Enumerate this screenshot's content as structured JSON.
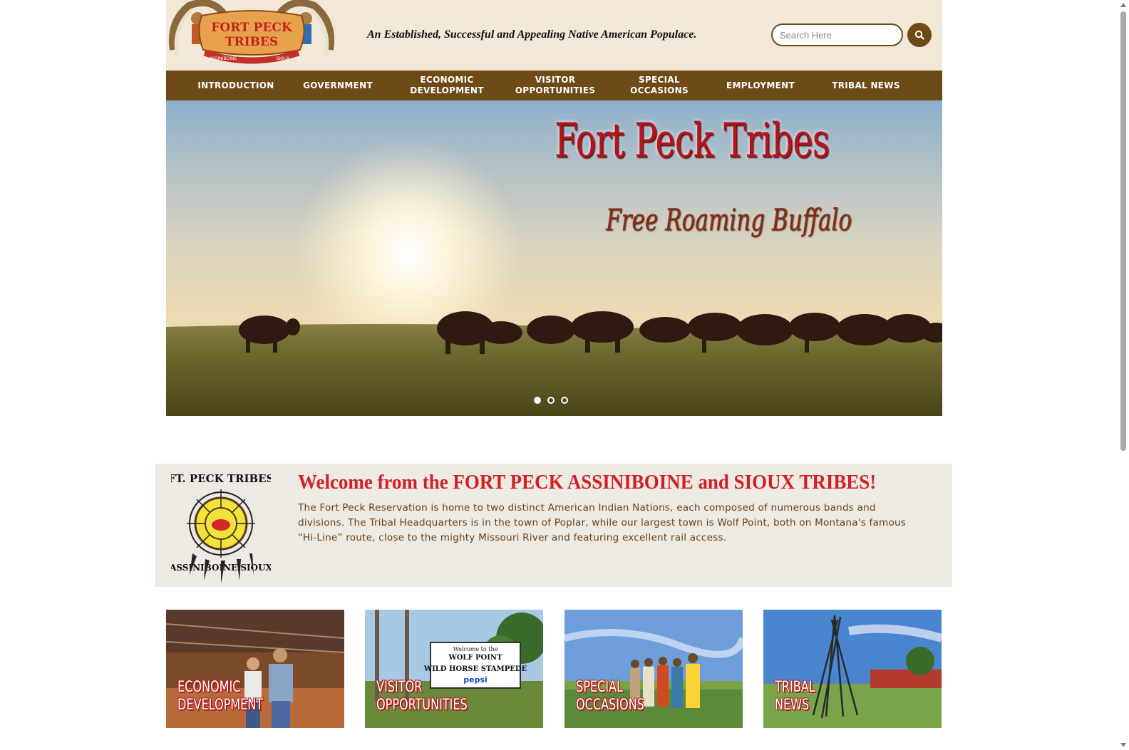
{
  "header": {
    "logo_text": [
      "FORT PECK",
      "TRIBES"
    ],
    "logo_ribbon": [
      "ASSINIBOINE",
      "SIOUX"
    ],
    "tagline": "An Established, Successful and Appealing Native American Populace.",
    "search_placeholder": "Search Here"
  },
  "nav": {
    "items": [
      {
        "label": "INTRODUCTION"
      },
      {
        "label": "GOVERNMENT"
      },
      {
        "label": "ECONOMIC\nDEVELOPMENT"
      },
      {
        "label": "VISITOR\nOPPORTUNITIES"
      },
      {
        "label": "SPECIAL\nOCCASIONS"
      },
      {
        "label": "EMPLOYMENT"
      },
      {
        "label": "TRIBAL NEWS"
      }
    ]
  },
  "hero": {
    "title": "Fort Peck Tribes",
    "subtitle": "Free Roaming Buffalo",
    "slide_count": 3,
    "active_slide": 1
  },
  "welcome": {
    "seal_text_top": "FT. PECK TRIBES",
    "seal_text_bottom": "ASSINIBOINE SIOUX",
    "title": "Welcome from the FORT PECK ASSINIBOINE and SIOUX TRIBES!",
    "body": "The Fort Peck Reservation is home to two distinct American Indian Nations, each composed of numerous bands and divisions. The Tribal Headquarters is in the town of Poplar, while our largest town is Wolf Point, both on Montana's famous “Hi-Line” route, close to the mighty Missouri River and featuring excellent rail access."
  },
  "tiles": [
    {
      "label": "ECONOMIC\nDEVELOPMENT"
    },
    {
      "label": "VISITOR\nOPPORTUNITIES",
      "sign_lines": [
        "Welcome to the",
        "WOLF POINT",
        "WILD HORSE STAMPEDE"
      ],
      "sign_brand": "pepsi"
    },
    {
      "label": "SPECIAL\nOCCASIONS"
    },
    {
      "label": "TRIBAL\nNEWS"
    }
  ],
  "colors": {
    "header_bg": "#f2e8d8",
    "nav_bg": "#6e4a16",
    "welcome_title": "#d21f26",
    "welcome_text": "#6b4416",
    "welcome_bg": "#ede9e3"
  }
}
